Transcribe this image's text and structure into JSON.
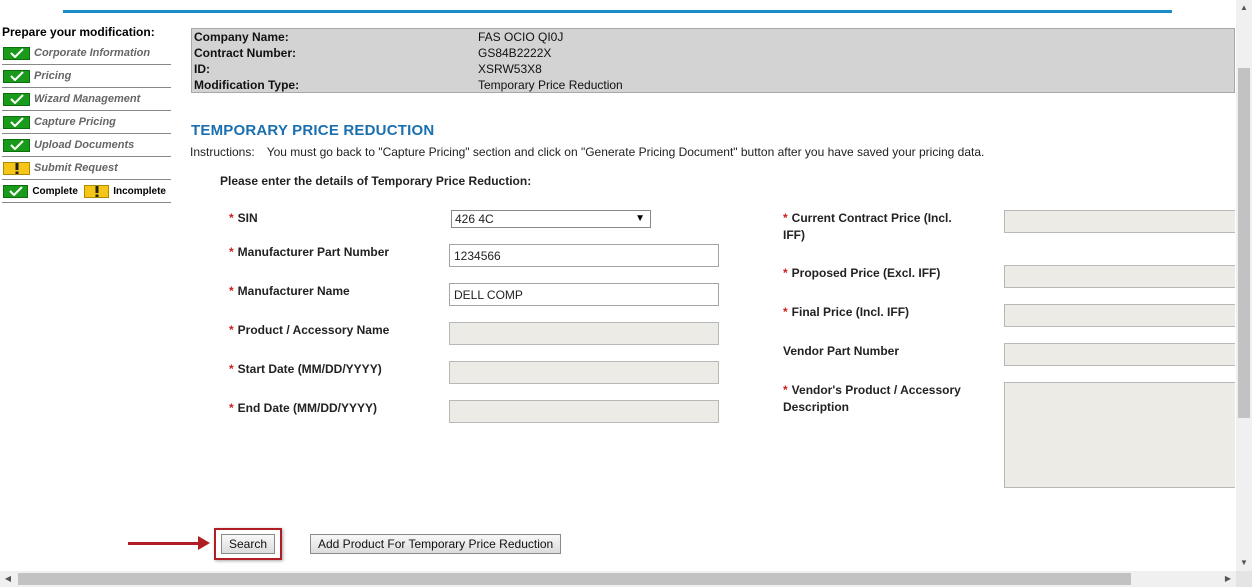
{
  "sidebar": {
    "heading": "Prepare your modification:",
    "items": [
      {
        "label": "Corporate Information",
        "status": "complete"
      },
      {
        "label": "Pricing",
        "status": "complete"
      },
      {
        "label": "Wizard Management",
        "status": "complete"
      },
      {
        "label": "Capture Pricing",
        "status": "complete"
      },
      {
        "label": "Upload Documents",
        "status": "complete"
      },
      {
        "label": "Submit Request",
        "status": "incomplete"
      }
    ],
    "legend": {
      "complete": "Complete",
      "incomplete": "Incomplete"
    }
  },
  "info": {
    "company_label": "Company Name:",
    "company_value": "FAS OCIO QI0J",
    "contract_label": "Contract Number:",
    "contract_value": "GS84B2222X",
    "id_label": "ID:",
    "id_value": "XSRW53X8",
    "modtype_label": "Modification Type:",
    "modtype_value": "Temporary Price Reduction"
  },
  "page": {
    "title": "TEMPORARY PRICE REDUCTION",
    "instructions_label": "Instructions:",
    "instructions_text": "You must go back to \"Capture Pricing\" section and click on \"Generate Pricing Document\" button after you have saved your pricing data.",
    "subheading": "Please enter the details of Temporary Price Reduction:"
  },
  "form": {
    "required_mark": "*",
    "sin_label": "SIN",
    "sin_value": "426 4C",
    "mpn_label": "Manufacturer Part Number",
    "mpn_value": "1234566",
    "mname_label": "Manufacturer Name",
    "mname_value": "DELL COMP",
    "product_label": "Product / Accessory Name",
    "product_value": "",
    "start_label": "Start Date (MM/DD/YYYY)",
    "start_value": "",
    "end_label": "End Date (MM/DD/YYYY)",
    "end_value": "",
    "current_price_label": "Current Contract Price (Incl. IFF)",
    "proposed_price_label": "Proposed Price (Excl. IFF)",
    "final_price_label": "Final Price (Incl. IFF)",
    "vendor_pn_label": "Vendor Part Number",
    "vendor_desc_label": "Vendor's Product / Accessory Description"
  },
  "buttons": {
    "search": "Search",
    "add_product": "Add Product For Temporary Price Reduction"
  },
  "icons": {
    "complete": "check-icon",
    "incomplete": "exclamation-icon"
  },
  "colors": {
    "accent_blue": "#1a6fb0",
    "rule_blue": "#1a8dc8",
    "complete_green": "#1a9a1a",
    "incomplete_yellow": "#f5c518",
    "required_red": "#cc2020",
    "highlight_red": "#b01e24"
  }
}
